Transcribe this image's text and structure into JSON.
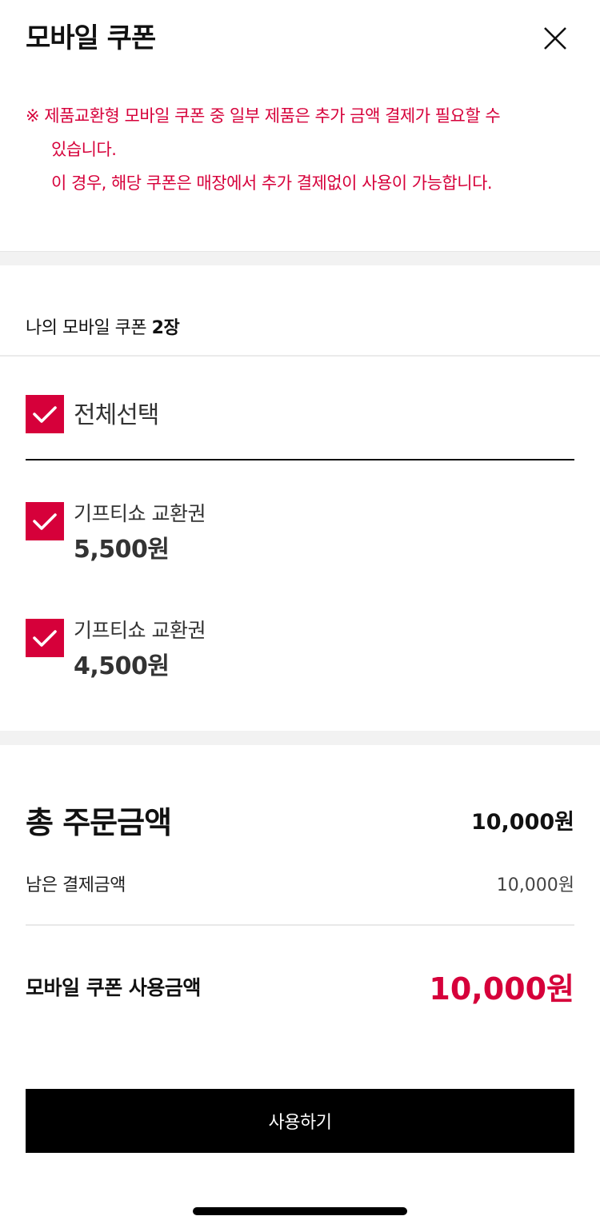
{
  "header": {
    "title": "모바일 쿠폰",
    "close_icon": "close-icon"
  },
  "notice": {
    "line1": "※ 제품교환형 모바일 쿠폰 중 일부 제품은 추가 금액 결제가 필요할 수",
    "line2": "있습니다.",
    "line3": "이 경우, 해당 쿠폰은 매장에서 추가 결제없이 사용이 가능합니다."
  },
  "coupon_count": {
    "prefix": "나의 모바일 쿠폰 ",
    "count": "2장"
  },
  "select_all": {
    "label": "전체선택",
    "checked": true
  },
  "coupons": [
    {
      "name": "기프티쇼 교환권",
      "price": "5,500원",
      "checked": true
    },
    {
      "name": "기프티쇼 교환권",
      "price": "4,500원",
      "checked": true
    }
  ],
  "summary": {
    "total_label": "총 주문금액",
    "total_value": "10,000원",
    "remaining_label": "남은 결제금액",
    "remaining_value": "10,000원",
    "coupon_use_label": "모바일 쿠폰 사용금액",
    "coupon_use_value": "10,000원"
  },
  "action": {
    "use_button_label": "사용하기"
  },
  "colors": {
    "accent": "#d6003a",
    "button_bg": "#000000",
    "band_bg": "#f2f2f2"
  }
}
